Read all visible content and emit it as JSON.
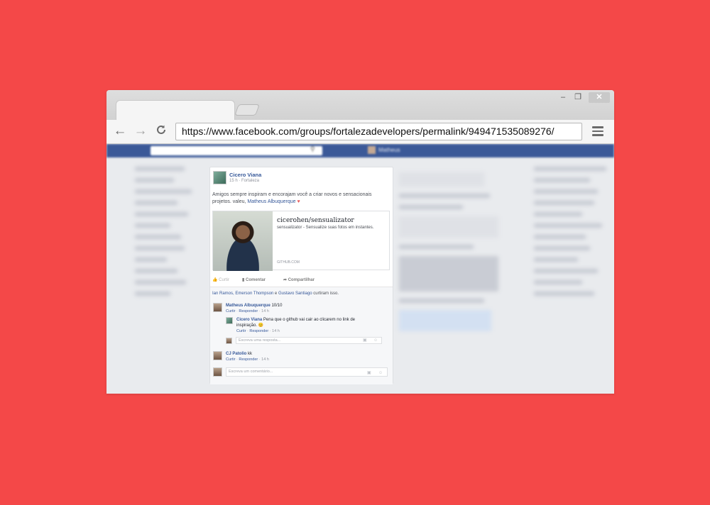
{
  "browser": {
    "url": "https://www.facebook.com/groups/fortalezadevelopers/permalink/949471535089276/",
    "win_close": "✕",
    "win_min": "–",
    "win_max": "❐",
    "back_icon": "←",
    "forward_icon": "→",
    "reload_icon": "C"
  },
  "facebook": {
    "user_name": "Matheus",
    "search_icon": "search-icon",
    "post": {
      "author": "Cicero Viana",
      "meta": "15 h · Fortaleza",
      "text_before": "Amigos sempre inspiram e encorajam você a criar novos e sensacionais projetos. valeu, ",
      "mention": "Matheus Albuquerque",
      "heart": "♥",
      "link_title": "cicerohen/sensualizator",
      "link_desc": "sensualizator - Sensualize suas fotos em instantes.",
      "link_domain": "GITHUB.COM",
      "actions": {
        "like": "Curtir",
        "comment": "Comentar",
        "share": "Compartilhar"
      },
      "likes": {
        "names": "Ian Ramos, Emerson Thompson",
        "and": " e ",
        "last": "Gustavo Santiago",
        "suffix": " curtiram isso."
      },
      "comments": [
        {
          "author": "Matheus Albuquerque",
          "text": " 10/10",
          "like": "Curtir",
          "reply": "Responder",
          "time": "14 h"
        },
        {
          "author": "Cicero Viana",
          "text": " Pena que o github vai cair ao clicarem no link de",
          "text2": "inspiração. 😊",
          "like": "Curtir",
          "reply": "Responder",
          "time": "14 h"
        },
        {
          "author": "CJ Patolio",
          "text": " kk",
          "like": "Curtir",
          "reply": "Responder",
          "time": "14 h"
        }
      ],
      "reply_placeholder": "Escreva uma resposta...",
      "comment_placeholder": "Escreva um comentário..."
    }
  }
}
